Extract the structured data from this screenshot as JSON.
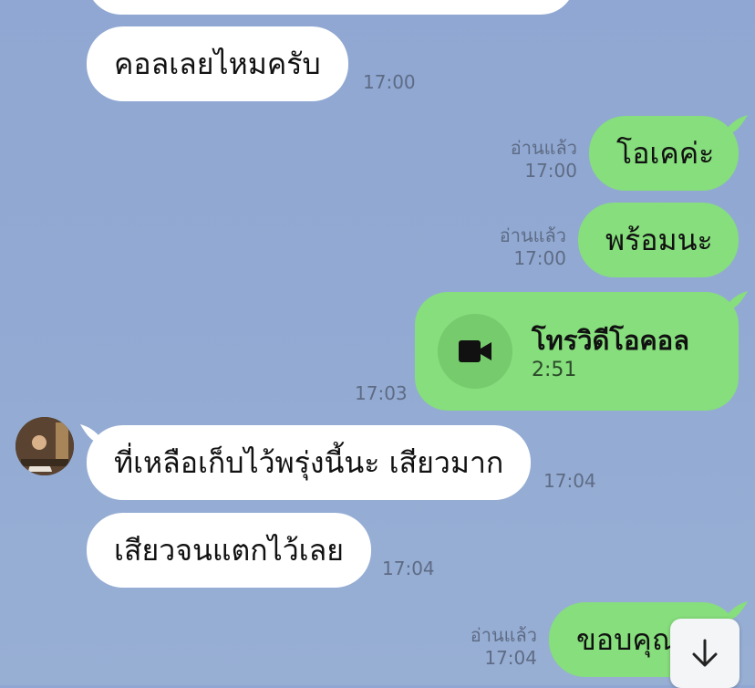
{
  "messages": [
    {
      "text": "คอลเลยไหมครับ",
      "time": "17:00"
    },
    {
      "text": "โอเคค่ะ",
      "read": "อ่านแล้ว",
      "time": "17:00"
    },
    {
      "text": "พร้อมนะ",
      "read": "อ่านแล้ว",
      "time": "17:00"
    },
    {
      "call_title": "โทรวิดีโอคอล",
      "call_duration": "2:51",
      "time": "17:03"
    },
    {
      "text": "ที่เหลือเก็บไว้พรุ่งนี้นะ เสียวมาก",
      "time": "17:04"
    },
    {
      "text": "เสียวจนแตกไว้เลย",
      "time": "17:04"
    },
    {
      "text": "ขอบคุณ",
      "read": "อ่านแล้ว",
      "time": "17:04"
    }
  ],
  "icons": {
    "call": "video-camera-icon",
    "scroll": "arrow-down-icon"
  },
  "colors": {
    "background": "#93abd3",
    "outgoing_bubble": "#86de7c",
    "incoming_bubble": "#ffffff"
  }
}
